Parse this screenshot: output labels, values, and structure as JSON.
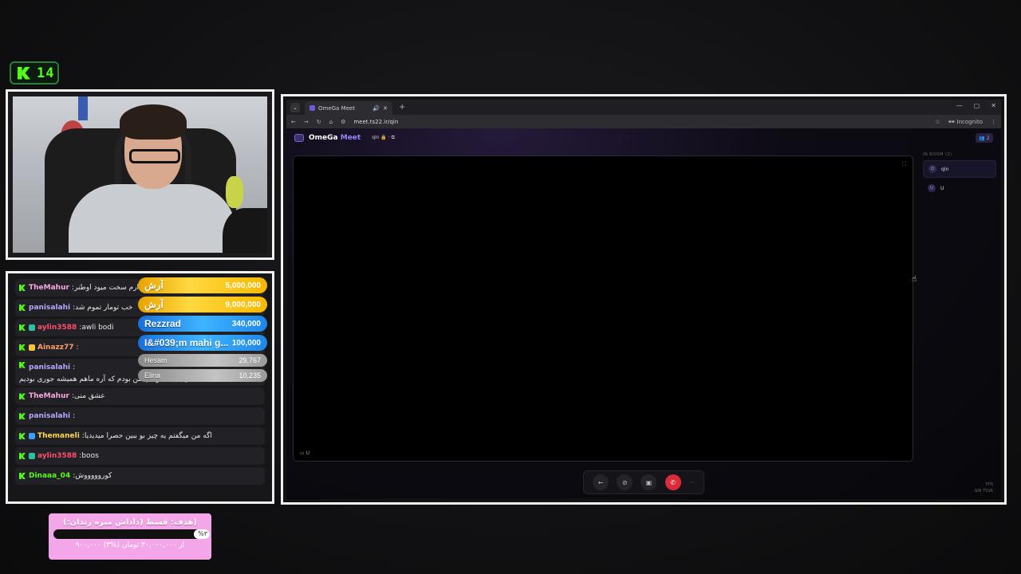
{
  "kick": {
    "viewer_count": "14"
  },
  "chat": {
    "messages": [
      {
        "user": "TheMahur",
        "user_color": "#f7a7e0",
        "text": "مادت دارم سخت میود اوطنر",
        "badge_color": ""
      },
      {
        "user": "panisalahi",
        "user_color": "#b9a6ff",
        "text": "خب تومار تموم شد",
        "badge_color": ""
      },
      {
        "user": "aylin3588",
        "user_color": "#ff4d6d",
        "text": "awli bodi",
        "badge_color": "#2fbf9f"
      },
      {
        "user": "Ainazz77",
        "user_color": "#ff9d6b",
        "text": "",
        "badge_color": "#f5c542"
      },
      {
        "user": "panisalahi",
        "user_color": "#b9a6ff",
        "text": "آماده ای باید که وقتی من بودم که آره ماهم همیشه جوری بودیم",
        "badge_color": ""
      },
      {
        "user": "TheMahur",
        "user_color": "#f7a7e0",
        "text": "عشق منی",
        "badge_color": ""
      },
      {
        "user": "panisalahi",
        "user_color": "#b9a6ff",
        "text": "",
        "badge_color": ""
      },
      {
        "user": "Themaneli",
        "user_color": "#ffd84d",
        "text": "اگه من میگفتم یه چیز بو ببین حصرا میدیدیا",
        "badge_color": "#3aa0ff"
      },
      {
        "user": "aylin3588",
        "user_color": "#ff4d6d",
        "text": "boos",
        "badge_color": "#2fbf9f"
      },
      {
        "user": "Dinaaa_04",
        "user_color": "#53fc18",
        "text": "کوروووووش",
        "badge_color": ""
      }
    ]
  },
  "leaderboard": [
    {
      "name": "آرش",
      "amount": "5,000,000",
      "tier": "gold"
    },
    {
      "name": "آرش",
      "amount": "9,000,000",
      "tier": "gold"
    },
    {
      "name": "Rezzrad",
      "amount": "340,000",
      "tier": "blue"
    },
    {
      "name": "I&#039;m mahi g...",
      "amount": "100,000",
      "tier": "blue"
    },
    {
      "name": "Hesam",
      "amount": "29,767",
      "tier": "grey"
    },
    {
      "name": "Elina",
      "amount": "10,235",
      "tier": "grey"
    }
  ],
  "goal": {
    "title": "هدف: قسط (داداش میره زندان:))",
    "percent_label": "%۳",
    "progress_fraction": 0.03,
    "subtitle": "۹۰۰,۰۰۰ از ۳۰,۰۰۰,۰۰۰ تومان (%۳)"
  },
  "browser": {
    "tab_title": "OmeGa Meet",
    "new_tab_icon": "+",
    "url": "meet.ts22.ir/qin",
    "incognito_label": "Incognito",
    "window_controls": [
      "—",
      "▢",
      "✕"
    ]
  },
  "app": {
    "brand_primary": "OmeGa",
    "brand_accent": "Meet",
    "room_name": "qin",
    "people_count": "2",
    "stage_label": "U",
    "sidebar_heading": "IN ROOM (2)",
    "participants": [
      {
        "initial": "Q",
        "name": "qin"
      },
      {
        "initial": "U",
        "name": "U"
      }
    ],
    "network_lines": [
      "FPS",
      "GIN TSSR"
    ]
  }
}
